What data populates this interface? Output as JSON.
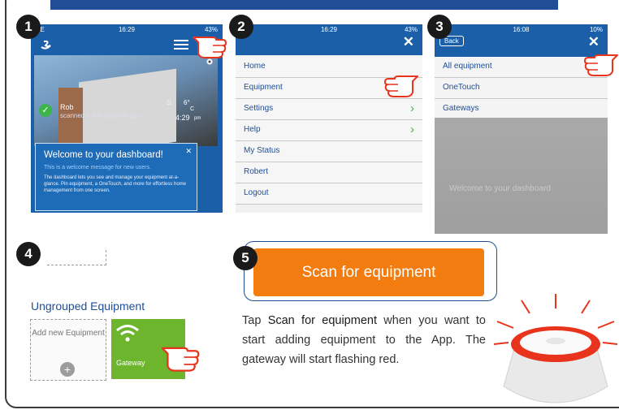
{
  "banner": {
    "title": ""
  },
  "steps": {
    "s1": "1",
    "s2": "2",
    "s3": "3",
    "s4": "4",
    "s5": "5"
  },
  "phone1": {
    "status_left": "EE",
    "time": "16:29",
    "status_right": "43%",
    "user_name": "Rob",
    "user_status": "scanned a few seconds ago",
    "temperature": "6°",
    "temp_unit": "C",
    "clock": "4:29",
    "clock_suffix": "pm",
    "welcome_title": "Welcome to your dashboard!",
    "welcome_subtitle": "This is a welcome message for new users.",
    "welcome_body": "The dashboard lets you see and manage your equipment at-a-glance. Pin equipment, a OneTouch, and more for effortless home management from one screen."
  },
  "phone2": {
    "status_left": "EE",
    "time": "16:29",
    "status_right": "43%",
    "menu": [
      {
        "label": "Home"
      },
      {
        "label": "Equipment"
      },
      {
        "label": "Settings"
      },
      {
        "label": "Help"
      },
      {
        "label": "My Status"
      },
      {
        "label": "Robert"
      },
      {
        "label": "Logout"
      }
    ]
  },
  "phone3": {
    "time": "16:08",
    "status_right": "10%",
    "back_label": "Back",
    "menu": [
      {
        "label": "All equipment"
      },
      {
        "label": "OneTouch"
      },
      {
        "label": "Gateways"
      }
    ],
    "ghost_text": "Welcome to your dashboard"
  },
  "step4": {
    "heading": "Ungrouped Equipment",
    "add_tile": "Add new Equipment",
    "gateway_label": "Gateway"
  },
  "step5": {
    "button": "Scan for equipment",
    "desc_pre": "Tap ",
    "desc_bold": "Scan for equipment",
    "desc_post": " when you want to start adding equipment to the App. The gateway will start flashing red."
  },
  "colors": {
    "brand_blue": "#1b5fa8",
    "accent_orange": "#f27c0f",
    "tile_green": "#6cb52d",
    "flash_red": "#e8341c"
  }
}
